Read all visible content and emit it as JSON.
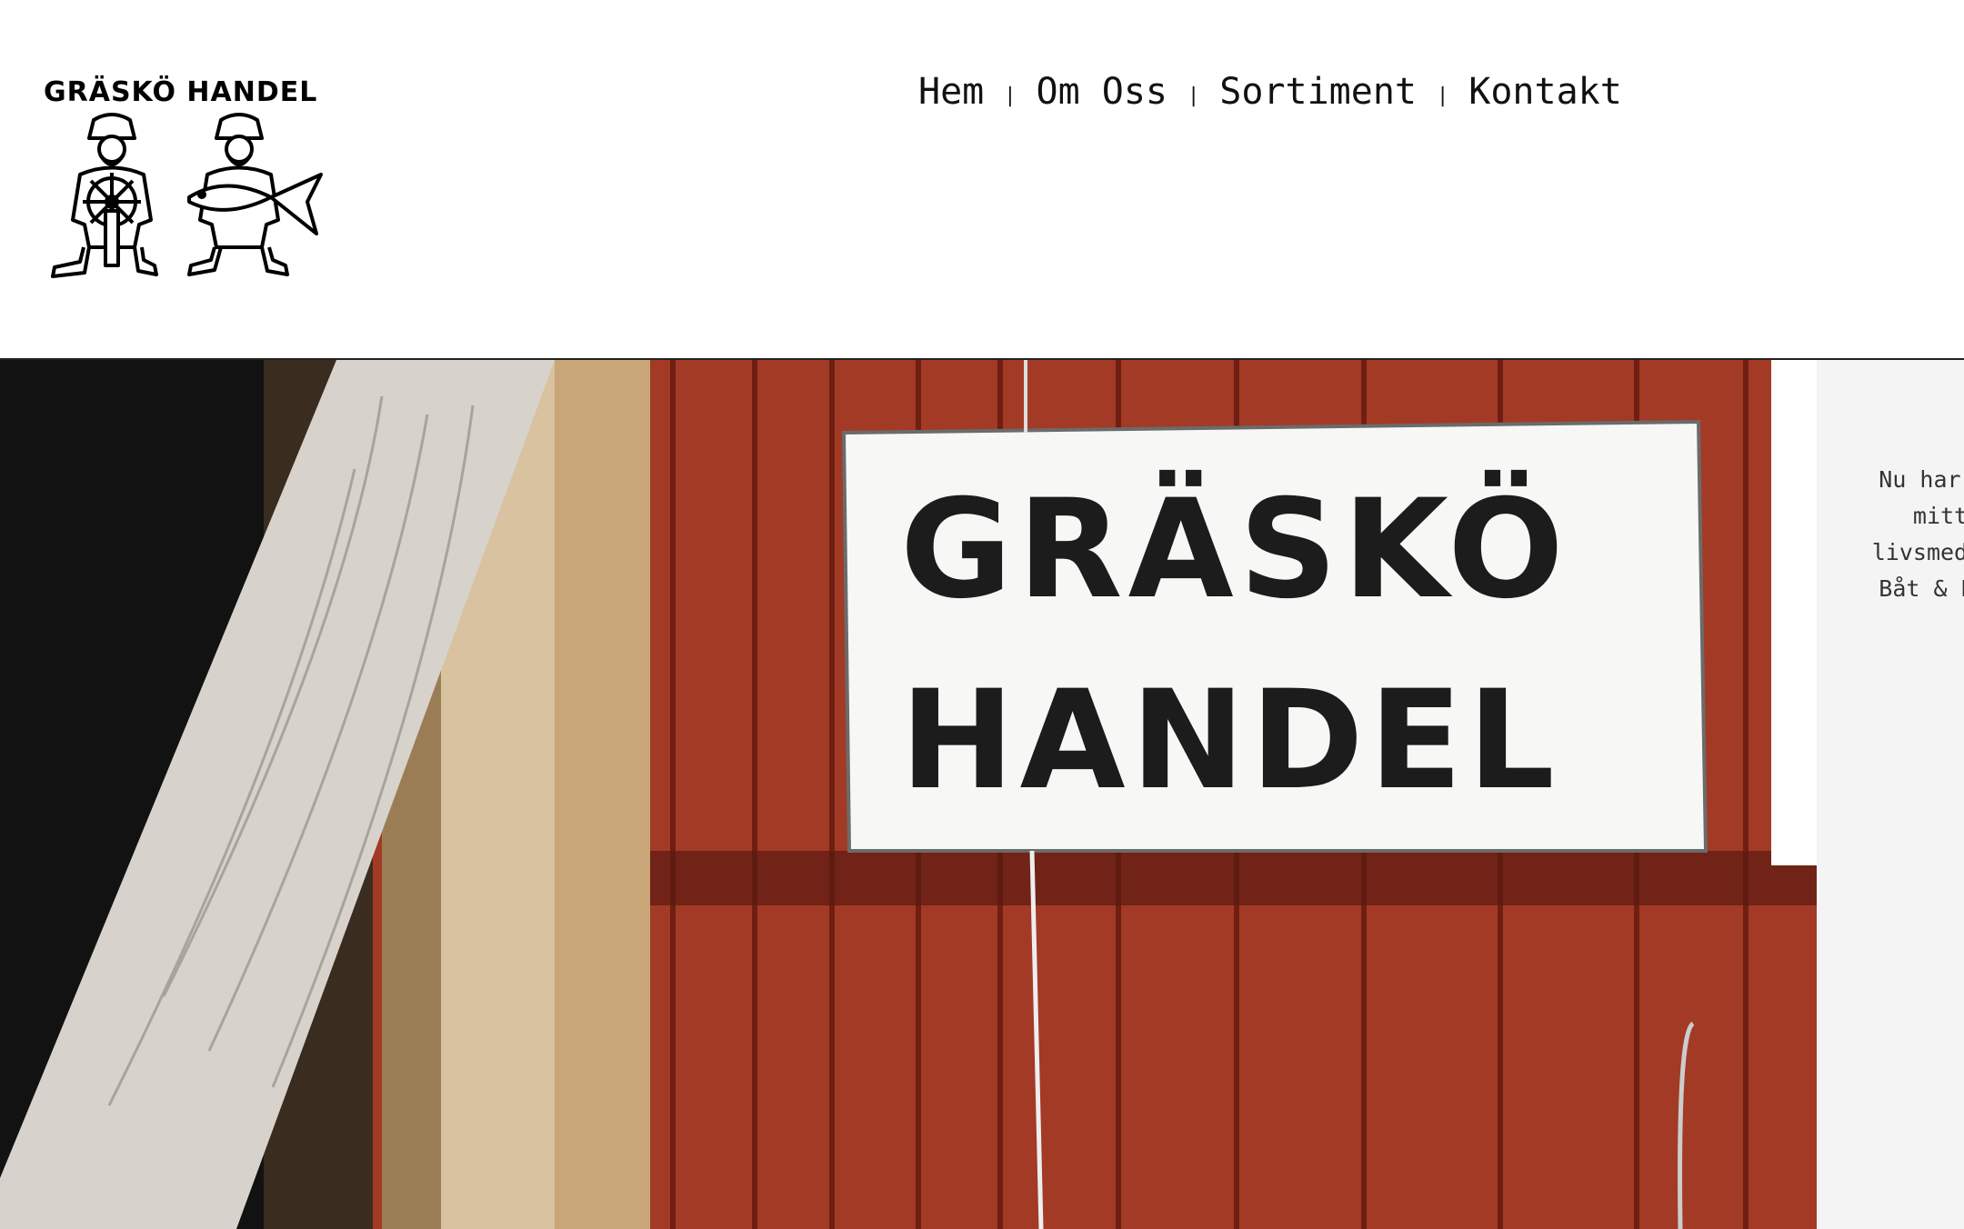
{
  "header": {
    "logo_text": "GRÄSKÖ HANDEL",
    "nav": {
      "items": [
        {
          "label": "Hem"
        },
        {
          "label": "Om Oss"
        },
        {
          "label": "Sortiment"
        },
        {
          "label": "Kontakt"
        }
      ],
      "separator": "|"
    }
  },
  "hero": {
    "sign_line1": "GRÄSKÖ",
    "sign_line2": "HANDEL"
  },
  "sidebar": {
    "lines": [
      "Nu har vi",
      "mitt",
      "livsmedel,",
      "Båt & Byg"
    ]
  },
  "colors": {
    "wall_red": "#a33a25",
    "sign_white": "#f7f7f5",
    "sign_text": "#1c1c1c",
    "divider": "#222222",
    "side_bg": "#f4f4f4"
  }
}
